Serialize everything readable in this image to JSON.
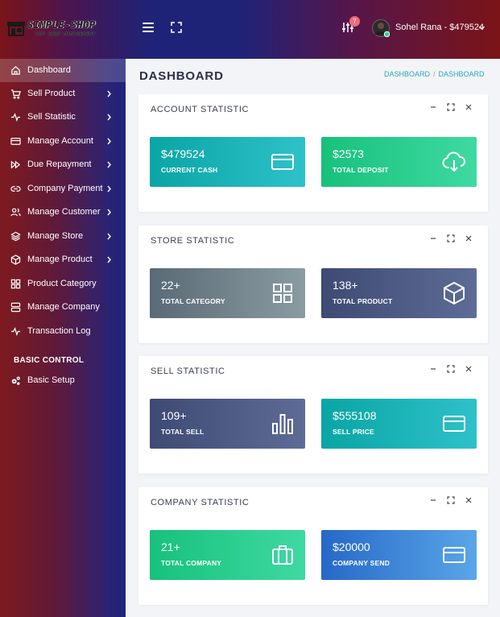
{
  "brand": {
    "name": "SIMPLE-SHOP",
    "tagline": "POP SHOP MANAGEMENT"
  },
  "header": {
    "notification_count": "7",
    "user_label": "Sohel Rana - $479524"
  },
  "sidebar": {
    "items": [
      {
        "label": "Dashboard",
        "icon": "home-icon",
        "active": true
      },
      {
        "label": "Sell Product",
        "icon": "cart-icon"
      },
      {
        "label": "Sell Statistic",
        "icon": "pulse-icon"
      },
      {
        "label": "Manage Account",
        "icon": "credit-card-icon"
      },
      {
        "label": "Due Repayment",
        "icon": "fast-forward-icon"
      },
      {
        "label": "Company Payment",
        "icon": "link-icon"
      },
      {
        "label": "Manage Customer",
        "icon": "users-icon"
      },
      {
        "label": "Manage Store",
        "icon": "layers-icon"
      },
      {
        "label": "Manage Product",
        "icon": "box-icon"
      },
      {
        "label": "Product Category",
        "icon": "grid-icon"
      },
      {
        "label": "Manage Company",
        "icon": "server-icon"
      },
      {
        "label": "Transaction Log",
        "icon": "activity-icon"
      }
    ],
    "section_title": "BASIC CONTROL",
    "basic_items": [
      {
        "label": "Basic Setup",
        "icon": "cogs-icon"
      }
    ]
  },
  "main": {
    "page_title": "DASHBOARD",
    "breadcrumb": [
      "DASHBOARD",
      "DASHBOARD"
    ],
    "panels": [
      {
        "title": "ACCOUNT STATISTIC",
        "cards": [
          {
            "value": "$479524",
            "caption": "CURRENT CASH",
            "icon": "credit-card-icon"
          },
          {
            "value": "$2573",
            "caption": "TOTAL DEPOSIT",
            "icon": "cloud-download-icon"
          }
        ]
      },
      {
        "title": "STORE STATISTIC",
        "cards": [
          {
            "value": "22+",
            "caption": "TOTAL CATEGORY",
            "icon": "grid-icon"
          },
          {
            "value": "138+",
            "caption": "TOTAL PRODUCT",
            "icon": "box-icon"
          }
        ]
      },
      {
        "title": "SELL STATISTIC",
        "cards": [
          {
            "value": "109+",
            "caption": "TOTAL SELL",
            "icon": "bar-chart-icon"
          },
          {
            "value": "$555108",
            "caption": "SELL PRICE",
            "icon": "credit-card-icon"
          }
        ]
      },
      {
        "title": "COMPANY STATISTIC",
        "cards": [
          {
            "value": "21+",
            "caption": "TOTAL COMPANY",
            "icon": "briefcase-icon"
          },
          {
            "value": "$20000",
            "caption": "COMPANY SEND",
            "icon": "credit-card-icon"
          }
        ]
      }
    ]
  }
}
